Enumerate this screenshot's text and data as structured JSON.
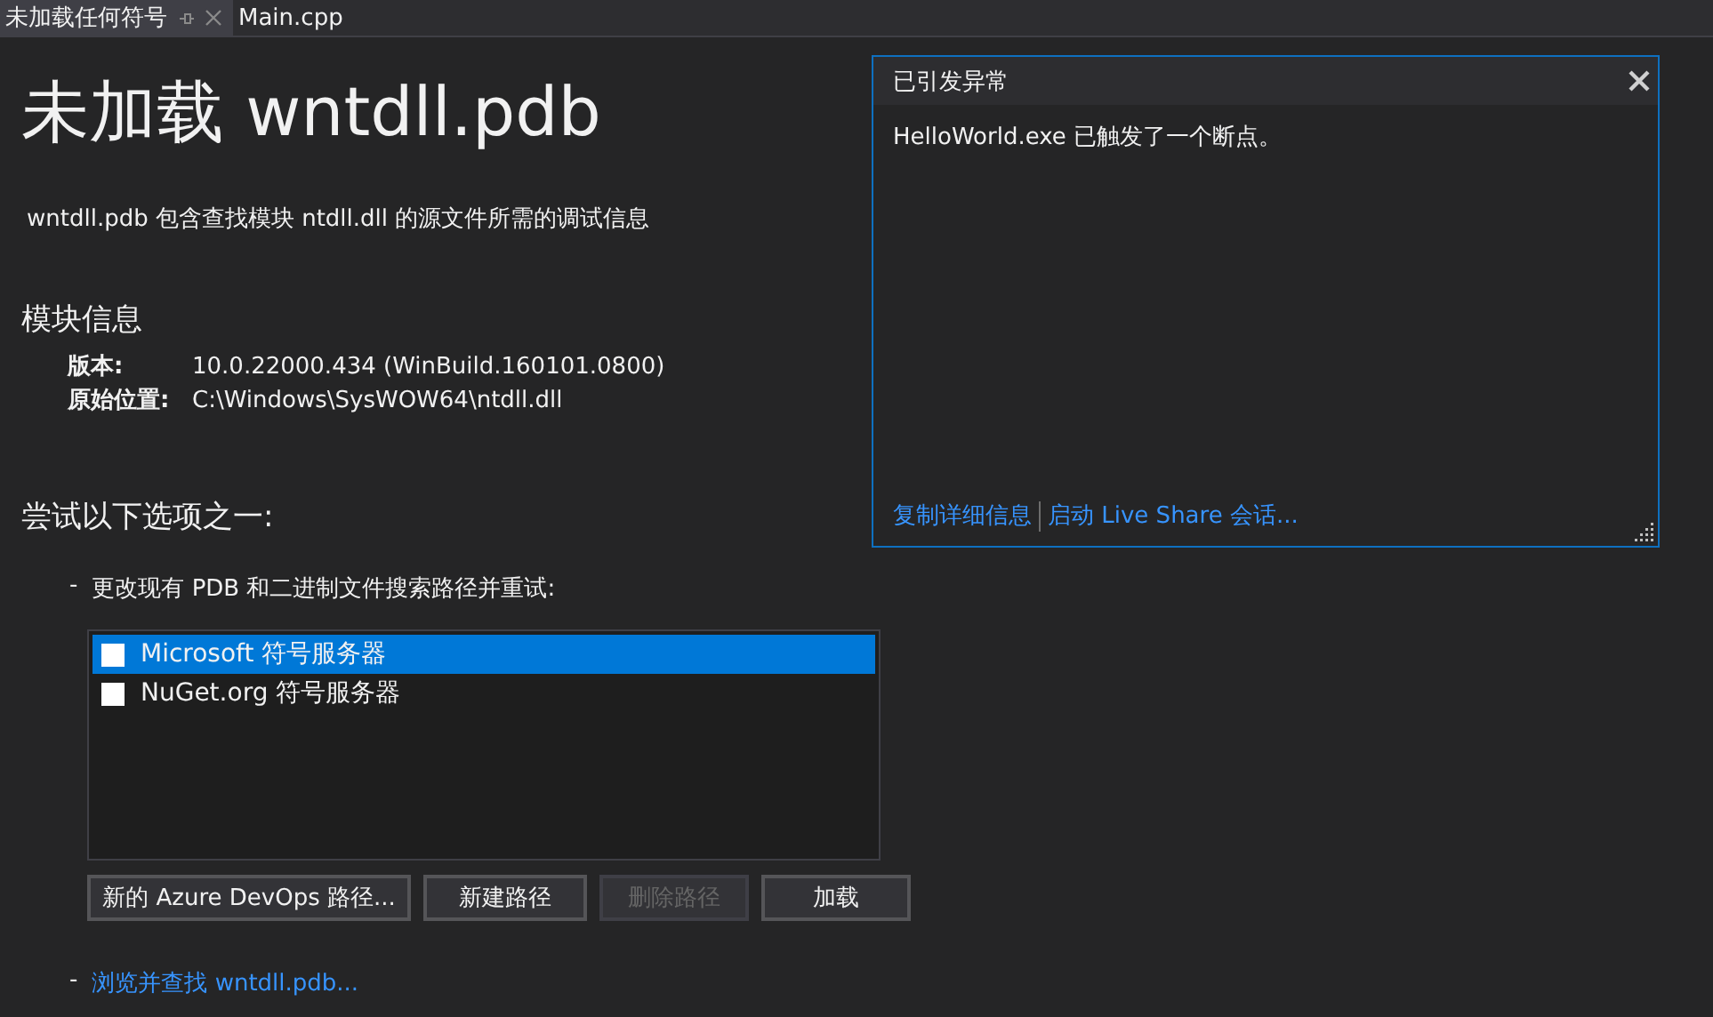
{
  "tabs": [
    {
      "label": "未加载任何符号",
      "selected": true
    },
    {
      "label": "Main.cpp",
      "selected": false
    }
  ],
  "title": "未加载 wntdll.pdb",
  "description": "wntdll.pdb 包含查找模块 ntdll.dll 的源文件所需的调试信息",
  "module_info": {
    "heading": "模块信息",
    "rows": [
      {
        "label": "版本:",
        "value": "10.0.22000.434 (WinBuild.160101.0800)"
      },
      {
        "label": "原始位置:",
        "value": "C:\\Windows\\SysWOW64\\ntdll.dll"
      }
    ]
  },
  "options": {
    "heading": "尝试以下选项之一:",
    "bullet": "-",
    "change_paths": "更改现有 PDB 和二进制文件搜索路径并重试:",
    "servers": [
      {
        "label": "Microsoft 符号服务器",
        "checked": false,
        "selected": true
      },
      {
        "label": "NuGet.org 符号服务器",
        "checked": false,
        "selected": false
      }
    ],
    "buttons": [
      {
        "label": "新的 Azure DevOps 路径...",
        "disabled": false
      },
      {
        "label": "新建路径",
        "disabled": false
      },
      {
        "label": "删除路径",
        "disabled": true
      },
      {
        "label": "加载",
        "disabled": false
      }
    ],
    "browse_bullet": "-",
    "browse_link": "浏览并查找 wntdll.pdb..."
  },
  "exception_popup": {
    "title": "已引发异常",
    "message": "HelloWorld.exe 已触发了一个断点。",
    "links": [
      "复制详细信息",
      "启动 Live Share 会话..."
    ]
  }
}
